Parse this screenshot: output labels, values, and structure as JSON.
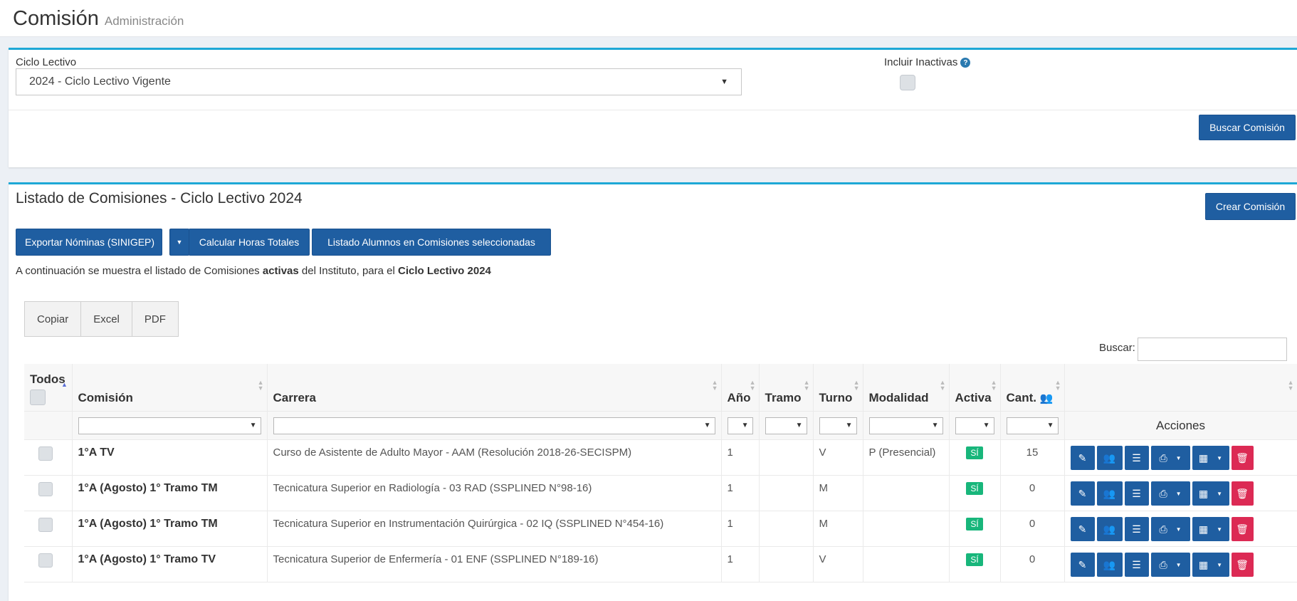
{
  "header": {
    "title": "Comisión",
    "subtitle": "Administración"
  },
  "filters": {
    "ciclo_label": "Ciclo Lectivo",
    "ciclo_value": "2024 - Ciclo Lectivo Vigente",
    "inactivas_label": "Incluir Inactivas",
    "search_button": "Buscar Comisión"
  },
  "listing": {
    "title": "Listado de Comisiones - Ciclo Lectivo 2024",
    "create_button": "Crear Comisión",
    "export_button": "Exportar Nóminas (SINIGEP)",
    "hours_button": "Calcular Horas Totales",
    "students_button": "Listado Alumnos en Comisiones seleccionadas",
    "info_prefix": "A continuación se muestra el listado de Comisiones ",
    "info_bold1": "activas",
    "info_middle": " del Instituto, para el ",
    "info_bold2": "Ciclo Lectivo 2024",
    "dt_buttons": [
      "Copiar",
      "Excel",
      "PDF"
    ],
    "search_label": "Buscar:"
  },
  "table": {
    "columns": {
      "todos": "Todos",
      "comision": "Comisión",
      "carrera": "Carrera",
      "anio": "Año",
      "tramo": "Tramo",
      "turno": "Turno",
      "modalidad": "Modalidad",
      "activa": "Activa",
      "cant": "Cant.",
      "acciones": "Acciones"
    },
    "rows": [
      {
        "comision": "1°A TV",
        "carrera": "Curso de Asistente de Adulto Mayor - AAM (Resolución 2018-26-SECISPM)",
        "anio": "1",
        "tramo": "",
        "turno": "V",
        "modalidad": "P (Presencial)",
        "activa": "SÍ",
        "cant": "15"
      },
      {
        "comision": "1°A (Agosto) 1° Tramo TM",
        "carrera": "Tecnicatura Superior en Radiología - 03 RAD (SSPLINED N°98-16)",
        "anio": "1",
        "tramo": "",
        "turno": "M",
        "modalidad": "",
        "activa": "SÍ",
        "cant": "0"
      },
      {
        "comision": "1°A (Agosto) 1° Tramo TM",
        "carrera": "Tecnicatura Superior en Instrumentación Quirúrgica - 02 IQ (SSPLINED N°454-16)",
        "anio": "1",
        "tramo": "",
        "turno": "M",
        "modalidad": "",
        "activa": "SÍ",
        "cant": "0"
      },
      {
        "comision": "1°A (Agosto) 1° Tramo TV",
        "carrera": "Tecnicatura Superior de Enfermería - 01 ENF (SSPLINED N°189-16)",
        "anio": "1",
        "tramo": "",
        "turno": "V",
        "modalidad": "",
        "activa": "SÍ",
        "cant": "0"
      }
    ]
  }
}
